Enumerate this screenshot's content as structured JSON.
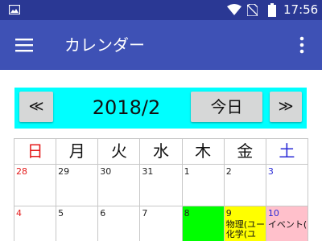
{
  "status_bar": {
    "time": "17:56",
    "icons": [
      "image-icon",
      "wifi-icon",
      "no-sim-icon",
      "battery-icon"
    ]
  },
  "app_bar": {
    "title": "カレンダー",
    "icons": [
      "menu-icon",
      "more-vert-icon"
    ],
    "background": "#3e51b5"
  },
  "nav": {
    "prev_label": "≪",
    "month": "2018/2",
    "today_label": "今日",
    "next_label": "≫",
    "background": "#00ffff"
  },
  "weekdays": [
    "日",
    "月",
    "火",
    "水",
    "木",
    "金",
    "土"
  ],
  "weeks": [
    [
      {
        "day": "28",
        "bg": "#ffffff"
      },
      {
        "day": "29",
        "bg": "#ffffff"
      },
      {
        "day": "30",
        "bg": "#ffffff"
      },
      {
        "day": "31",
        "bg": "#ffffff"
      },
      {
        "day": "1",
        "bg": "#ffffff"
      },
      {
        "day": "2",
        "bg": "#ffffff"
      },
      {
        "day": "3",
        "bg": "#ffffff"
      }
    ],
    [
      {
        "day": "4",
        "bg": "#ffffff"
      },
      {
        "day": "5",
        "bg": "#ffffff"
      },
      {
        "day": "6",
        "bg": "#ffffff"
      },
      {
        "day": "7",
        "bg": "#ffffff"
      },
      {
        "day": "8",
        "bg": "#00ff00"
      },
      {
        "day": "9",
        "bg": "#ffff00",
        "events": [
          "物理(ユー",
          "化学(ユ"
        ]
      },
      {
        "day": "10",
        "bg": "#ffc0cb",
        "events": [
          "イベント("
        ]
      }
    ]
  ],
  "colors": {
    "status_bar": "#2a3894",
    "sunday": "#e41a1a",
    "saturday": "#2a2ad6",
    "grid": "#c7c7c7"
  }
}
